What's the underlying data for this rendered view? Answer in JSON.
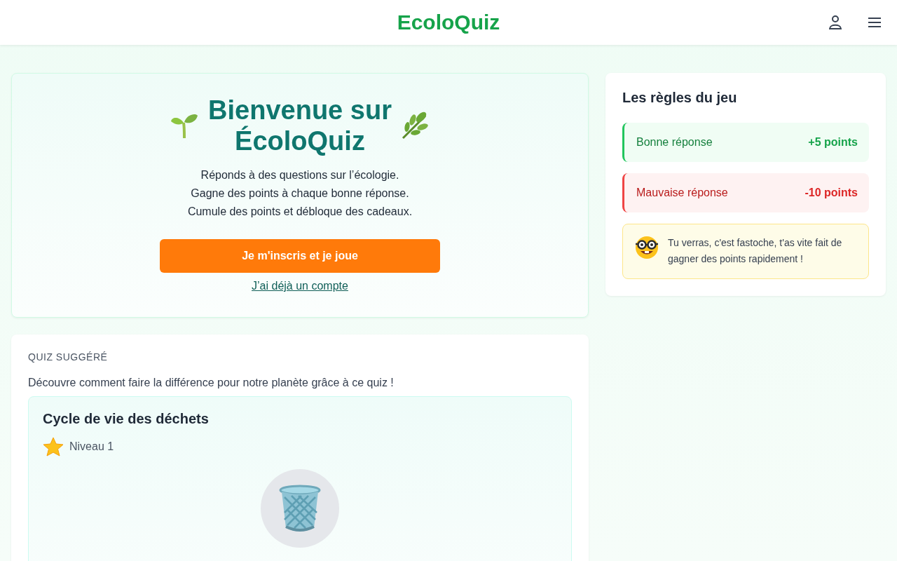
{
  "header": {
    "logo": "EcoloQuiz"
  },
  "welcome": {
    "title_line1": "Bienvenue sur",
    "title_line2": "ÉcoloQuiz",
    "lines": [
      "Réponds à des questions sur l’écologie.",
      "Gagne des points à chaque bonne réponse.",
      "Cumule des points et débloque des cadeaux."
    ],
    "signup_button": "Je m'inscris et je joue",
    "login_link": "J’ai déjà un compte"
  },
  "suggested": {
    "label": "QUIZ SUGGÉRÉ",
    "intro": "Découvre comment faire la différence pour notre planète grâce à ce quiz !",
    "quiz": {
      "title": "Cycle de vie des déchets",
      "level": "Niveau 1"
    }
  },
  "rules": {
    "title": "Les règles du jeu",
    "items": [
      {
        "kind": "good",
        "label": "Bonne réponse",
        "points": "+5 points"
      },
      {
        "kind": "bad",
        "label": "Mauvaise réponse",
        "points": "-10 points"
      }
    ],
    "tip": "Tu verras, c'est fastoche, t'as vite fait de gagner des points rapidement !"
  }
}
